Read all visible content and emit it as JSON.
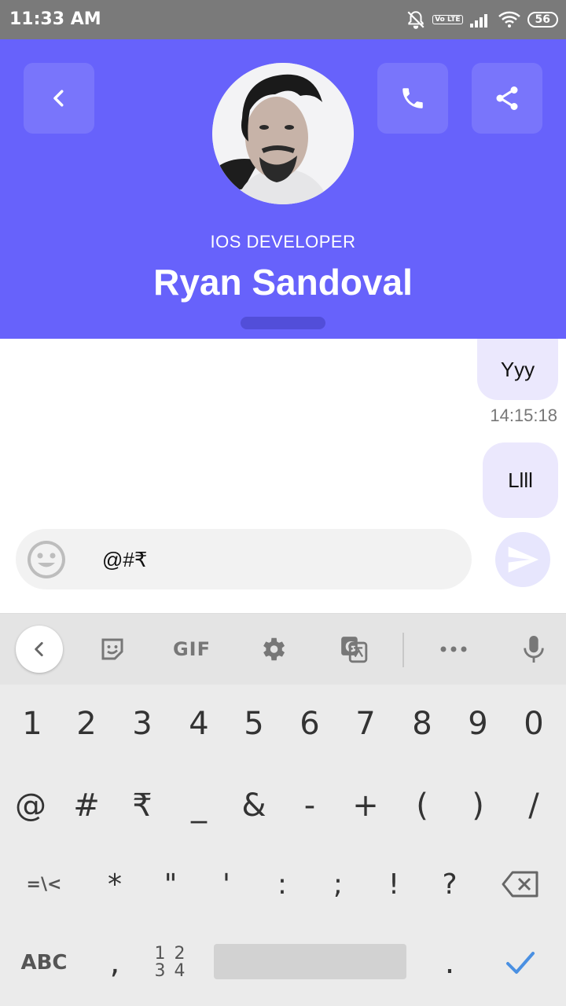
{
  "status_bar": {
    "time": "11:33 AM",
    "volte": "Vo LTE",
    "battery": "56"
  },
  "header": {
    "role": "IOS DEVELOPER",
    "name": "Ryan Sandoval",
    "background_color": "#6762fb"
  },
  "messages": [
    {
      "text": "Yyy",
      "time": "14:15:18"
    },
    {
      "text": "Llll"
    }
  ],
  "composer": {
    "value": "@#₹"
  },
  "keyboard": {
    "toolbar": {
      "gif_label": "GIF"
    },
    "row1": [
      "1",
      "2",
      "3",
      "4",
      "5",
      "6",
      "7",
      "8",
      "9",
      "0"
    ],
    "row2": [
      "@",
      "#",
      "₹",
      "_",
      "&",
      "-",
      "+",
      "(",
      ")",
      "/"
    ],
    "row3_left": "=\\<",
    "row3": [
      "*",
      "\"",
      "'",
      ":",
      ";",
      "!",
      "?"
    ],
    "row4": {
      "abc": "ABC",
      "comma": ",",
      "symbols_top": "1 2",
      "symbols_bottom": "3 4",
      "period": "."
    }
  }
}
